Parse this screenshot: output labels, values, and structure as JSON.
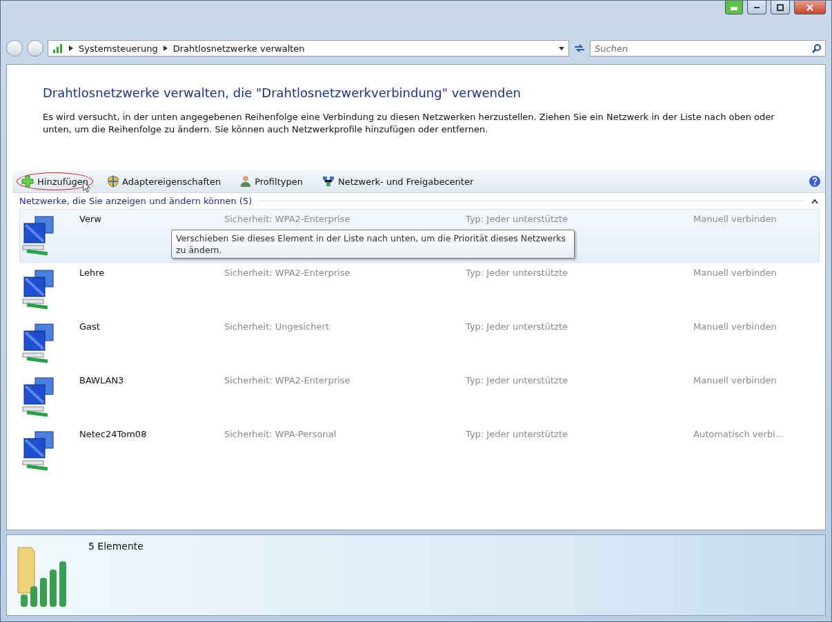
{
  "address_bar": {
    "breadcrumbs": [
      "Systemsteuerung",
      "Drahtlosnetzwerke verwalten"
    ],
    "search_placeholder": "Suchen"
  },
  "heading": "Drahtlosnetzwerke verwalten, die \"Drahtlosnetzwerkverbindung\" verwenden",
  "description": "Es wird versucht, in der unten angegebenen Reihenfolge eine Verbindung zu diesen Netzwerken herzustellen. Ziehen Sie ein Netzwerk in der Liste nach oben oder unten, um die Reihenfolge zu ändern. Sie können auch Netzwerkprofile hinzufügen oder entfernen.",
  "toolbar": [
    {
      "kind": "add",
      "label": "Hinzufügen",
      "highlighted": true
    },
    {
      "kind": "shield",
      "label": "Adaptereigenschaften",
      "highlighted": false
    },
    {
      "kind": "person",
      "label": "Profiltypen",
      "highlighted": false
    },
    {
      "kind": "network",
      "label": "Netzwerk- und Freigabecenter",
      "highlighted": false
    }
  ],
  "group": {
    "title": "Netzwerke, die Sie anzeigen und ändern können (5)",
    "expanded": true
  },
  "networks": [
    {
      "name": "Verw",
      "security": "Sicherheit: WPA2-Enterprise",
      "type": "Typ: Jeder unterstützte",
      "mode": "Manuell verbinden",
      "selected": true
    },
    {
      "name": "Lehre",
      "security": "Sicherheit: WPA2-Enterprise",
      "type": "Typ: Jeder unterstützte",
      "mode": "Manuell verbinden",
      "selected": false
    },
    {
      "name": "Gast",
      "security": "Sicherheit: Ungesichert",
      "type": "Typ: Jeder unterstützte",
      "mode": "Manuell verbinden",
      "selected": false
    },
    {
      "name": "BAWLAN3",
      "security": "Sicherheit: WPA2-Enterprise",
      "type": "Typ: Jeder unterstützte",
      "mode": "Manuell verbinden",
      "selected": false
    },
    {
      "name": "Netec24Tom08",
      "security": "Sicherheit: WPA-Personal",
      "type": "Typ: Jeder unterstützte",
      "mode": "Automatisch verbi...",
      "selected": false
    }
  ],
  "tooltip": "Verschieben Sie dieses Element in der Liste nach unten, um die Priorität dieses Netzwerks zu ändern.",
  "status_bar": {
    "count": "5 Elemente"
  }
}
